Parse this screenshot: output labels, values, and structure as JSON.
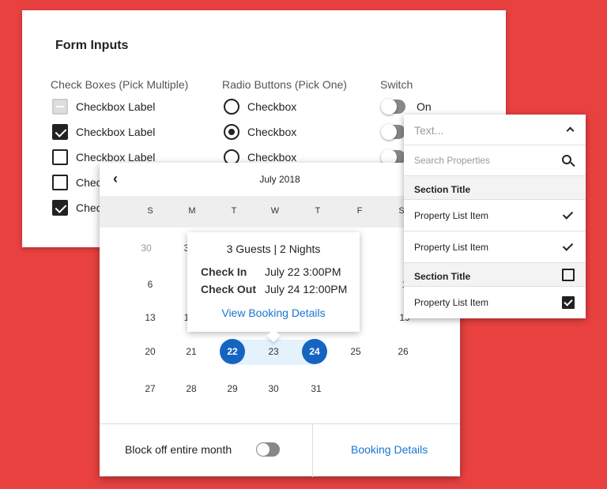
{
  "form": {
    "title": "Form Inputs",
    "checkbox_heading": "Check Boxes (Pick Multiple)",
    "radio_heading": "Radio Buttons (Pick One)",
    "switch_heading": "Switch",
    "checkboxes": [
      {
        "label": "Checkbox Label",
        "state": "indeterminate"
      },
      {
        "label": "Checkbox Label",
        "state": "checked"
      },
      {
        "label": "Checkbox Label",
        "state": "unchecked"
      },
      {
        "label": "Checkbox Label",
        "state": "unchecked"
      },
      {
        "label": "Checkbox Label",
        "state": "checked"
      }
    ],
    "radios": [
      {
        "label": "Checkbox",
        "selected": false
      },
      {
        "label": "Checkbox",
        "selected": true
      },
      {
        "label": "Checkbox",
        "selected": false
      }
    ],
    "switches": [
      {
        "label": "On"
      }
    ]
  },
  "calendar": {
    "month_label": "July 2018",
    "weekdays": [
      "S",
      "M",
      "T",
      "W",
      "T",
      "F",
      "S"
    ],
    "days": {
      "row1": [
        "30",
        "3"
      ],
      "row2": [
        "6",
        "1"
      ],
      "row3": [
        "13",
        "1",
        "19"
      ],
      "row4": [
        "20",
        "21",
        "22",
        "23",
        "24",
        "25",
        "26"
      ],
      "row5": [
        "27",
        "28",
        "29",
        "30",
        "31"
      ]
    },
    "block_month_label": "Block off entire month",
    "booking_details_link": "Booking Details",
    "accent_color": "#1565c0"
  },
  "booking_tip": {
    "header": "3 Guests | 2 Nights",
    "check_in_label": "Check In",
    "check_in_value": "July 22 3:00PM",
    "check_out_label": "Check Out",
    "check_out_value": "July 24 12:00PM",
    "view_link": "View Booking Details"
  },
  "properties": {
    "text_placeholder": "Text...",
    "search_placeholder": "Search Properties",
    "sections": [
      {
        "title": "Section Title",
        "items": [
          "Property List Item",
          "Property List Item"
        ]
      },
      {
        "title": "Section Title",
        "items": [
          "Property List Item"
        ]
      }
    ]
  }
}
